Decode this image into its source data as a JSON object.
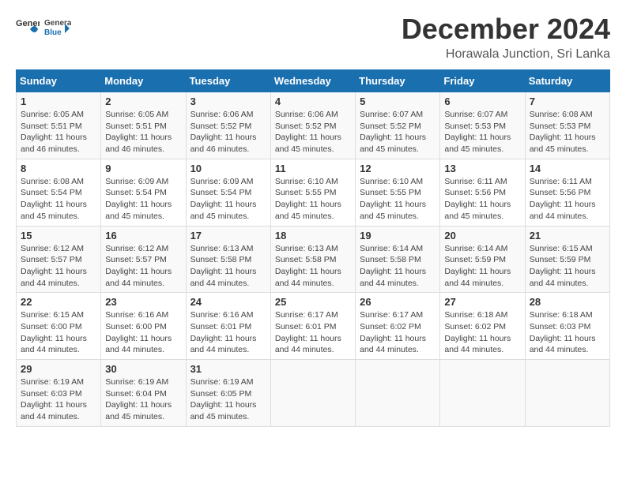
{
  "header": {
    "logo_general": "General",
    "logo_blue": "Blue",
    "title": "December 2024",
    "subtitle": "Horawala Junction, Sri Lanka"
  },
  "weekdays": [
    "Sunday",
    "Monday",
    "Tuesday",
    "Wednesday",
    "Thursday",
    "Friday",
    "Saturday"
  ],
  "weeks": [
    [
      {
        "day": "1",
        "info": "Sunrise: 6:05 AM\nSunset: 5:51 PM\nDaylight: 11 hours\nand 46 minutes."
      },
      {
        "day": "2",
        "info": "Sunrise: 6:05 AM\nSunset: 5:51 PM\nDaylight: 11 hours\nand 46 minutes."
      },
      {
        "day": "3",
        "info": "Sunrise: 6:06 AM\nSunset: 5:52 PM\nDaylight: 11 hours\nand 46 minutes."
      },
      {
        "day": "4",
        "info": "Sunrise: 6:06 AM\nSunset: 5:52 PM\nDaylight: 11 hours\nand 45 minutes."
      },
      {
        "day": "5",
        "info": "Sunrise: 6:07 AM\nSunset: 5:52 PM\nDaylight: 11 hours\nand 45 minutes."
      },
      {
        "day": "6",
        "info": "Sunrise: 6:07 AM\nSunset: 5:53 PM\nDaylight: 11 hours\nand 45 minutes."
      },
      {
        "day": "7",
        "info": "Sunrise: 6:08 AM\nSunset: 5:53 PM\nDaylight: 11 hours\nand 45 minutes."
      }
    ],
    [
      {
        "day": "8",
        "info": "Sunrise: 6:08 AM\nSunset: 5:54 PM\nDaylight: 11 hours\nand 45 minutes."
      },
      {
        "day": "9",
        "info": "Sunrise: 6:09 AM\nSunset: 5:54 PM\nDaylight: 11 hours\nand 45 minutes."
      },
      {
        "day": "10",
        "info": "Sunrise: 6:09 AM\nSunset: 5:54 PM\nDaylight: 11 hours\nand 45 minutes."
      },
      {
        "day": "11",
        "info": "Sunrise: 6:10 AM\nSunset: 5:55 PM\nDaylight: 11 hours\nand 45 minutes."
      },
      {
        "day": "12",
        "info": "Sunrise: 6:10 AM\nSunset: 5:55 PM\nDaylight: 11 hours\nand 45 minutes."
      },
      {
        "day": "13",
        "info": "Sunrise: 6:11 AM\nSunset: 5:56 PM\nDaylight: 11 hours\nand 45 minutes."
      },
      {
        "day": "14",
        "info": "Sunrise: 6:11 AM\nSunset: 5:56 PM\nDaylight: 11 hours\nand 44 minutes."
      }
    ],
    [
      {
        "day": "15",
        "info": "Sunrise: 6:12 AM\nSunset: 5:57 PM\nDaylight: 11 hours\nand 44 minutes."
      },
      {
        "day": "16",
        "info": "Sunrise: 6:12 AM\nSunset: 5:57 PM\nDaylight: 11 hours\nand 44 minutes."
      },
      {
        "day": "17",
        "info": "Sunrise: 6:13 AM\nSunset: 5:58 PM\nDaylight: 11 hours\nand 44 minutes."
      },
      {
        "day": "18",
        "info": "Sunrise: 6:13 AM\nSunset: 5:58 PM\nDaylight: 11 hours\nand 44 minutes."
      },
      {
        "day": "19",
        "info": "Sunrise: 6:14 AM\nSunset: 5:58 PM\nDaylight: 11 hours\nand 44 minutes."
      },
      {
        "day": "20",
        "info": "Sunrise: 6:14 AM\nSunset: 5:59 PM\nDaylight: 11 hours\nand 44 minutes."
      },
      {
        "day": "21",
        "info": "Sunrise: 6:15 AM\nSunset: 5:59 PM\nDaylight: 11 hours\nand 44 minutes."
      }
    ],
    [
      {
        "day": "22",
        "info": "Sunrise: 6:15 AM\nSunset: 6:00 PM\nDaylight: 11 hours\nand 44 minutes."
      },
      {
        "day": "23",
        "info": "Sunrise: 6:16 AM\nSunset: 6:00 PM\nDaylight: 11 hours\nand 44 minutes."
      },
      {
        "day": "24",
        "info": "Sunrise: 6:16 AM\nSunset: 6:01 PM\nDaylight: 11 hours\nand 44 minutes."
      },
      {
        "day": "25",
        "info": "Sunrise: 6:17 AM\nSunset: 6:01 PM\nDaylight: 11 hours\nand 44 minutes."
      },
      {
        "day": "26",
        "info": "Sunrise: 6:17 AM\nSunset: 6:02 PM\nDaylight: 11 hours\nand 44 minutes."
      },
      {
        "day": "27",
        "info": "Sunrise: 6:18 AM\nSunset: 6:02 PM\nDaylight: 11 hours\nand 44 minutes."
      },
      {
        "day": "28",
        "info": "Sunrise: 6:18 AM\nSunset: 6:03 PM\nDaylight: 11 hours\nand 44 minutes."
      }
    ],
    [
      {
        "day": "29",
        "info": "Sunrise: 6:19 AM\nSunset: 6:03 PM\nDaylight: 11 hours\nand 44 minutes."
      },
      {
        "day": "30",
        "info": "Sunrise: 6:19 AM\nSunset: 6:04 PM\nDaylight: 11 hours\nand 45 minutes."
      },
      {
        "day": "31",
        "info": "Sunrise: 6:19 AM\nSunset: 6:05 PM\nDaylight: 11 hours\nand 45 minutes."
      },
      {
        "day": "",
        "info": ""
      },
      {
        "day": "",
        "info": ""
      },
      {
        "day": "",
        "info": ""
      },
      {
        "day": "",
        "info": ""
      }
    ]
  ]
}
